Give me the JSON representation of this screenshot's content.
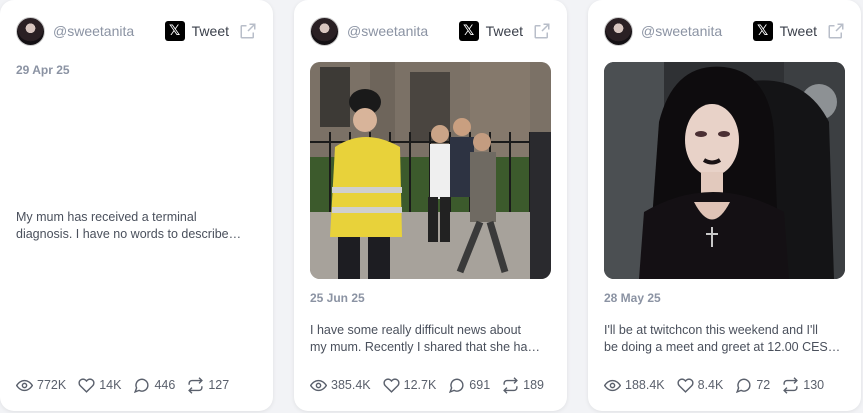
{
  "cards": [
    {
      "handle": "@sweetanita",
      "tweet_label": "Tweet",
      "date": "29 Apr 25",
      "text_line1": "My mum has received a terminal",
      "text_line2": "diagnosis. I have no words to describe…",
      "views": "772K",
      "likes": "14K",
      "replies": "446",
      "retweets": "127"
    },
    {
      "handle": "@sweetanita",
      "tweet_label": "Tweet",
      "date": "25 Jun 25",
      "text_line1": "I have some really difficult news about",
      "text_line2": "my mum. Recently I shared that she ha…",
      "views": "385.4K",
      "likes": "12.7K",
      "replies": "691",
      "retweets": "189"
    },
    {
      "handle": "@sweetanita",
      "tweet_label": "Tweet",
      "date": "28 May 25",
      "text_line1": "I'll be at twitchcon this weekend and I'll",
      "text_line2": "be doing a meet and greet at 12.00 CEST…",
      "views": "188.4K",
      "likes": "8.4K",
      "replies": "72",
      "retweets": "130"
    }
  ],
  "icons": {
    "x_logo": "x-logo-icon",
    "external": "external-link-icon",
    "views": "eye-icon",
    "likes": "heart-icon",
    "replies": "comment-icon",
    "retweets": "retweet-icon"
  }
}
